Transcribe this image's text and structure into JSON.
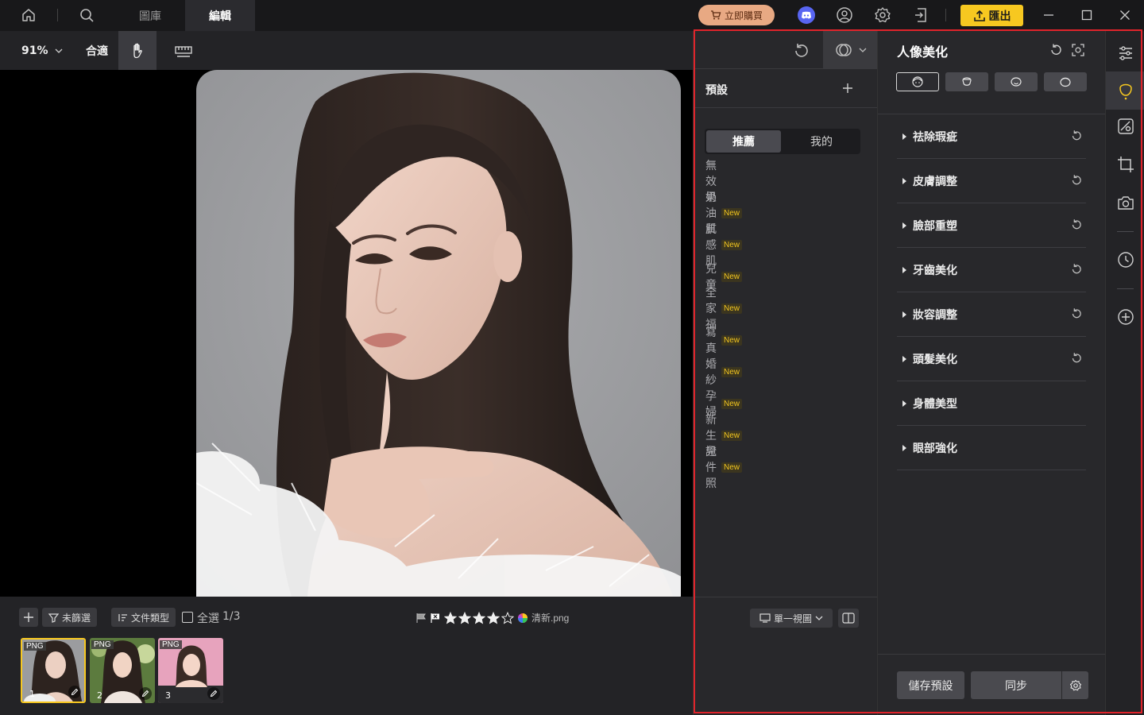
{
  "titlebar": {
    "tabs": [
      "圖庫",
      "編輯"
    ],
    "active_tab": "編輯",
    "buy_label": "立即購買",
    "export_label": "匯出",
    "icons": [
      "home-icon",
      "search-icon",
      "discord-icon",
      "user-icon",
      "settings-icon",
      "import-icon",
      "minimize-icon",
      "maximize-icon",
      "close-icon"
    ]
  },
  "toolbar": {
    "zoom": "91%",
    "fit_label": "合適",
    "hand_tool_active": true
  },
  "bottom": {
    "filter_label": "未篩選",
    "sort_label": "文件類型",
    "select_all_label": "全選",
    "count": "1/3",
    "rating": 4,
    "rating_max": 5,
    "preset_name": "清新.png",
    "thumbnails": [
      {
        "format": "PNG",
        "index": "1",
        "selected": true
      },
      {
        "format": "PNG",
        "index": "2",
        "selected": false
      },
      {
        "format": "PNG",
        "index": "3",
        "selected": false
      }
    ]
  },
  "presets": {
    "title": "預設",
    "tabs": [
      "推薦",
      "我的"
    ],
    "active_tab": "推薦",
    "new_tag": "New",
    "items": [
      {
        "label": "無效果",
        "is_new": false
      },
      {
        "label": "奶油肌",
        "is_new": true
      },
      {
        "label": "質感肌",
        "is_new": true
      },
      {
        "label": "兒童",
        "is_new": true
      },
      {
        "label": "全家福",
        "is_new": true
      },
      {
        "label": "寫真",
        "is_new": true
      },
      {
        "label": "婚紗",
        "is_new": true
      },
      {
        "label": "孕婦",
        "is_new": true
      },
      {
        "label": "新生兒",
        "is_new": true
      },
      {
        "label": "證件照",
        "is_new": true
      }
    ],
    "view_label": "單一視圖"
  },
  "adjust": {
    "title": "人像美化",
    "sections": [
      {
        "label": "祛除瑕疵",
        "resettable": true
      },
      {
        "label": "皮膚調整",
        "resettable": true
      },
      {
        "label": "臉部重塑",
        "resettable": true
      },
      {
        "label": "牙齒美化",
        "resettable": true
      },
      {
        "label": "妝容調整",
        "resettable": true
      },
      {
        "label": "頭髮美化",
        "resettable": true
      },
      {
        "label": "身體美型",
        "resettable": false
      },
      {
        "label": "眼部強化",
        "resettable": false
      }
    ],
    "save_preset_label": "儲存預設",
    "sync_label": "同步"
  },
  "colors": {
    "accent_yellow": "#f7c820",
    "highlight_red": "#e0242b",
    "buy_peach": "#e8a983"
  }
}
